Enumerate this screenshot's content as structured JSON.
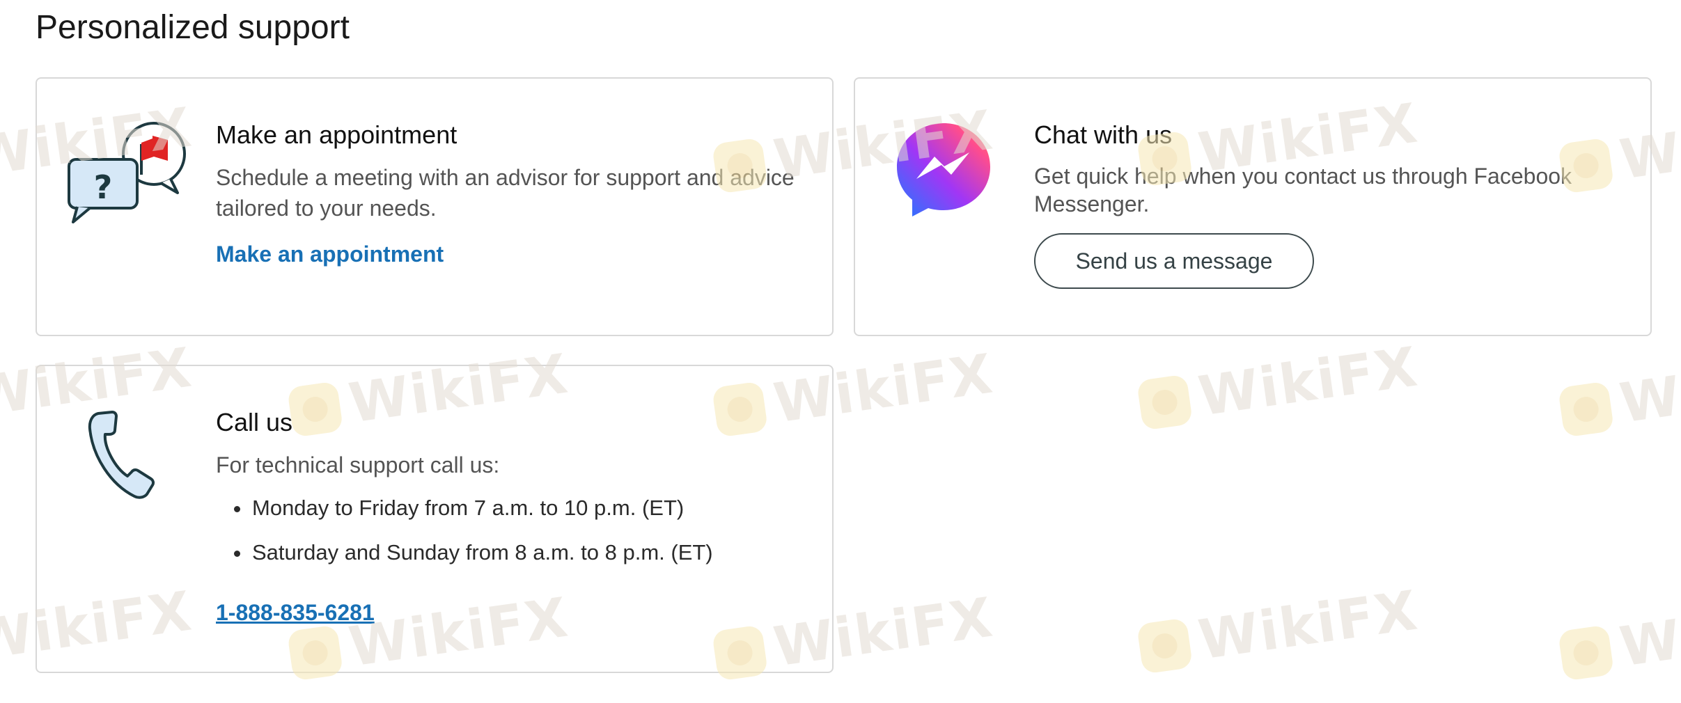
{
  "page_title": "Personalized support",
  "appointment": {
    "title": "Make an appointment",
    "description": "Schedule a meeting with an advisor for support and advice tailored to your needs.",
    "link_label": "Make an appointment",
    "icon": "chat-bubbles-flag-icon"
  },
  "chat": {
    "title": "Chat with us",
    "description": "Get quick help when you contact us through Facebook Messenger.",
    "button_label": "Send us a message",
    "icon": "messenger-icon"
  },
  "call": {
    "title": "Call us",
    "description": "For technical support call us:",
    "hours": [
      "Monday to Friday from 7 a.m. to 10 p.m. (ET)",
      "Saturday and Sunday from 8 a.m. to 8 p.m. (ET)"
    ],
    "phone": "1-888-835-6281",
    "icon": "phone-icon"
  },
  "watermark_text": "WikiFX",
  "colors": {
    "link": "#1870b5",
    "border": "#d8d8d8",
    "flag": "#e02424",
    "icon_fill": "#d6e8f7",
    "icon_stroke": "#1d3940"
  }
}
